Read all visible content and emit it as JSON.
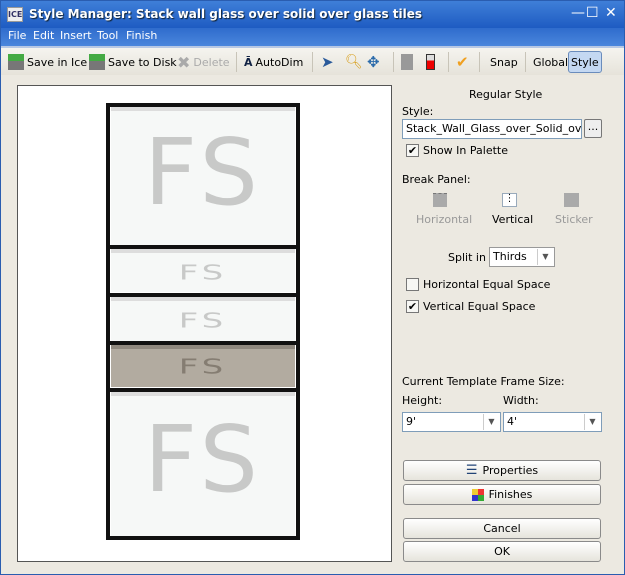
{
  "window": {
    "title": "Style Manager: Stack wall glass over solid  over glass tiles",
    "icon_text": "ICE"
  },
  "menu": [
    "File",
    "Edit",
    "Insert",
    "Tool",
    "Finish"
  ],
  "toolbar": {
    "save_ice": "Save in Ice",
    "save_disk": "Save to Disk",
    "delete": "Delete",
    "autodim": "AutoDim",
    "snap": "Snap",
    "global": "Global",
    "style": "Style"
  },
  "preview": {
    "panel_text": "FS"
  },
  "panel": {
    "heading": "Regular Style",
    "style_label": "Style:",
    "style_value": "Stack_Wall_Glass_over_Solid_over_Glass",
    "browse": "...",
    "show_in_palette": {
      "label": "Show In Palette",
      "checked": true
    },
    "break_panel_label": "Break Panel:",
    "break_options": [
      {
        "label": "Horizontal",
        "enabled": false
      },
      {
        "label": "Vertical",
        "enabled": true,
        "selected": true
      },
      {
        "label": "Sticker",
        "enabled": false
      }
    ],
    "split_label": "Split in",
    "split_value": "Thirds",
    "horizontal_equal": {
      "label": "Horizontal Equal Space",
      "checked": false
    },
    "vertical_equal": {
      "label": "Vertical Equal Space",
      "checked": true
    },
    "frame_size_label": "Current Template Frame Size:",
    "height_label": "Height:",
    "height_value": "9'",
    "width_label": "Width:",
    "width_value": "4'",
    "properties": "Properties",
    "finishes": "Finishes",
    "cancel": "Cancel",
    "ok": "OK"
  },
  "colors": {
    "title_bar": "#1e5bc2",
    "tinted_panel": "#b2aba0"
  }
}
